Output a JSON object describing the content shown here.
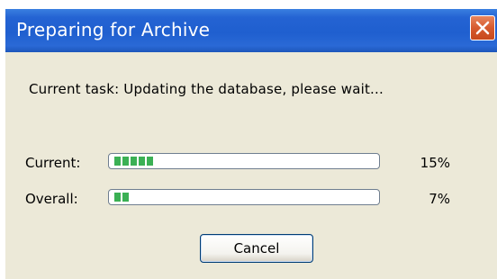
{
  "window": {
    "title": "Preparing for Archive",
    "close_icon": "close-icon"
  },
  "task": {
    "text": "Current task: Updating the database, please wait..."
  },
  "progress": {
    "current": {
      "label": "Current:",
      "percent_text": "15%",
      "value": 0.15
    },
    "overall": {
      "label": "Overall:",
      "percent_text": "7%",
      "value": 0.07
    }
  },
  "buttons": {
    "cancel_label": "Cancel"
  },
  "colors": {
    "titlebar": "#2463d3",
    "progress_fill": "#3bb054",
    "dialog_bg": "#ece9d8",
    "close_button": "#d65a2e"
  }
}
